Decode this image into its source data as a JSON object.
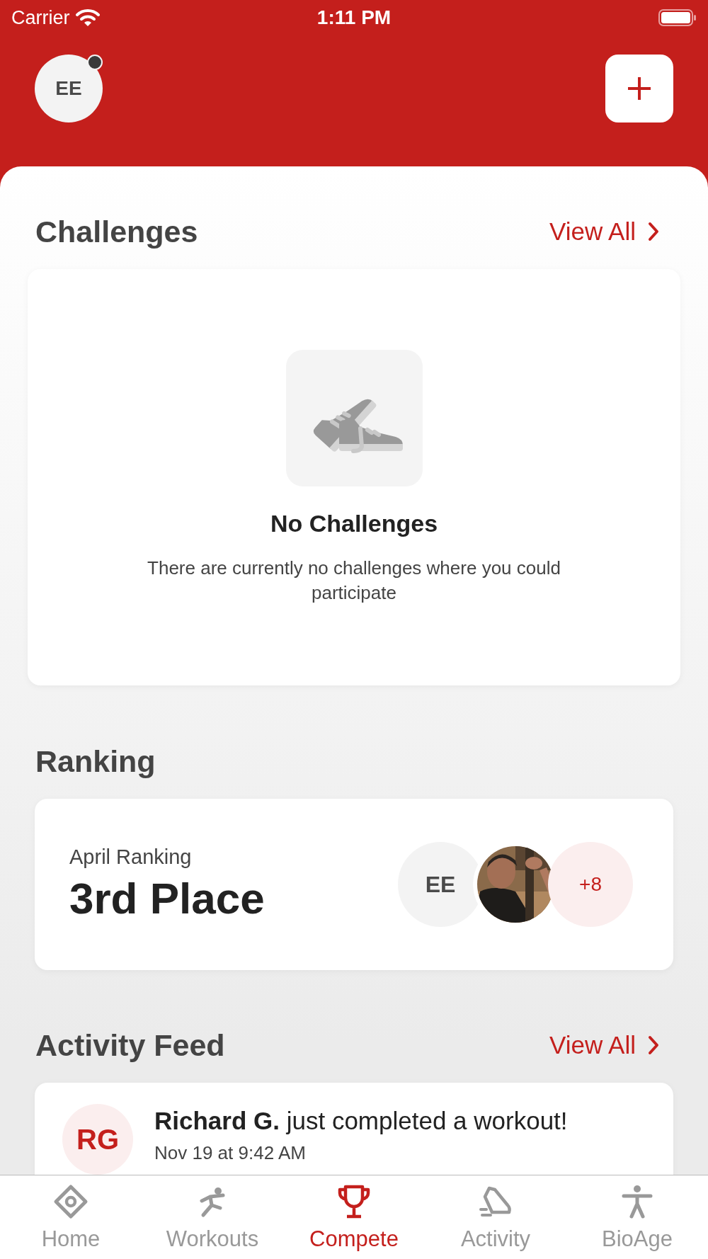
{
  "status_bar": {
    "carrier": "Carrier",
    "time": "1:11 PM"
  },
  "header": {
    "avatar": {
      "initials": "EE",
      "notification": true
    }
  },
  "challenges": {
    "title": "Challenges",
    "view_all": "View All",
    "empty": {
      "title": "No Challenges",
      "message": "There are currently no challenges where you could participate"
    }
  },
  "ranking": {
    "title": "Ranking",
    "card": {
      "label": "April Ranking",
      "place": "3rd Place",
      "participants": [
        {
          "kind": "initials",
          "text": "EE"
        },
        {
          "kind": "picture"
        },
        {
          "kind": "more",
          "text": "+8"
        }
      ]
    }
  },
  "activity_feed": {
    "title": "Activity Feed",
    "view_all": "View All",
    "items": [
      {
        "initials": "RG",
        "text": "**Richard G.** just completed a workout!",
        "time": "Nov 19 at 9:42 AM"
      }
    ]
  },
  "tab_bar": [
    {
      "kind": "home",
      "label": "Home",
      "selected": false
    },
    {
      "kind": "workouts",
      "label": "Workouts",
      "selected": false
    },
    {
      "kind": "compete",
      "label": "Compete",
      "selected": true
    },
    {
      "kind": "activity",
      "label": "Activity",
      "selected": false
    },
    {
      "kind": "bioage",
      "label": "BioAge",
      "selected": false
    }
  ]
}
